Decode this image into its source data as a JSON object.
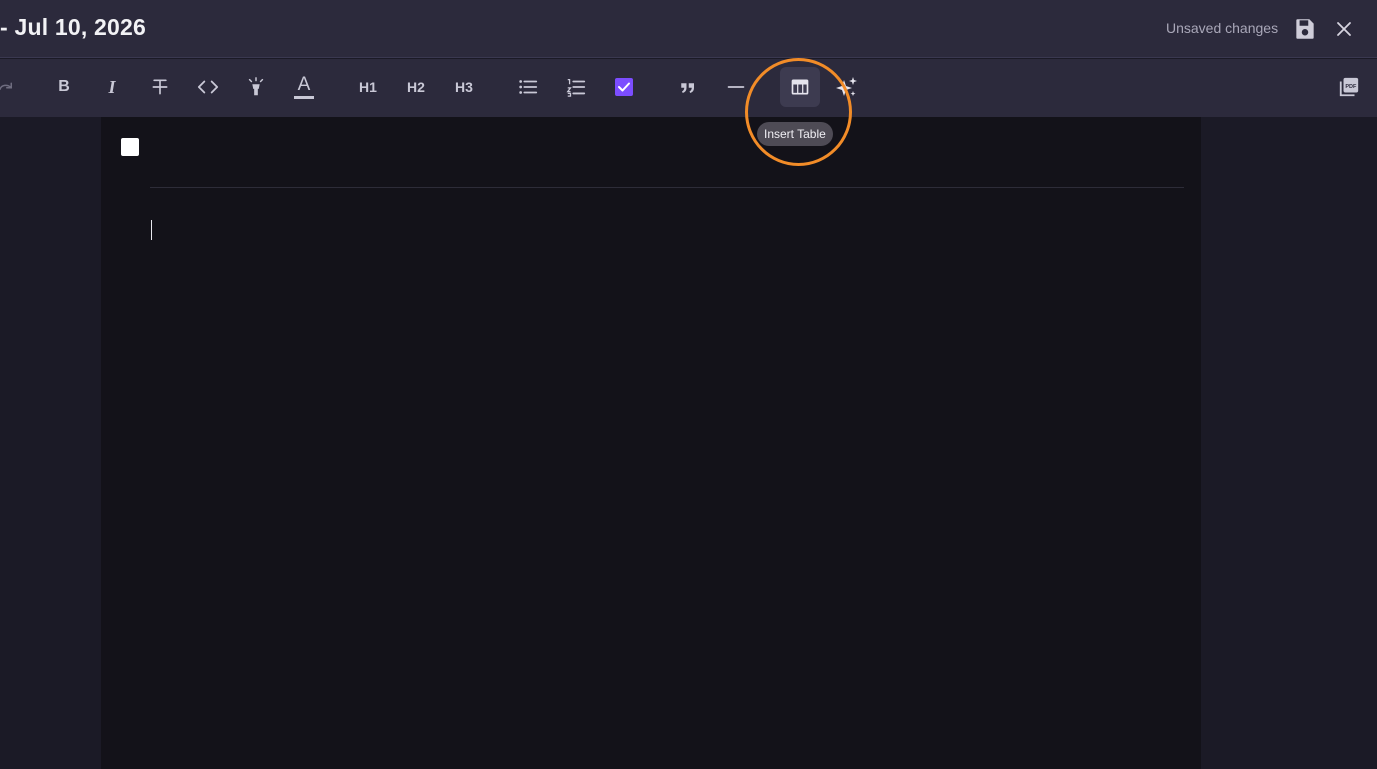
{
  "header": {
    "title": "- Jul 10, 2026",
    "status": "Unsaved changes",
    "save_icon": "save-icon",
    "close_icon": "close-icon"
  },
  "toolbar": {
    "buttons": [
      {
        "name": "redo",
        "icon": "redo-icon"
      },
      {
        "name": "bold",
        "icon": "bold-icon",
        "label": "B"
      },
      {
        "name": "italic",
        "icon": "italic-icon",
        "label": "I"
      },
      {
        "name": "strikethrough",
        "icon": "strikethrough-icon"
      },
      {
        "name": "code",
        "icon": "code-icon"
      },
      {
        "name": "highlight",
        "icon": "highlighter-icon"
      },
      {
        "name": "text-color",
        "icon": "text-color-icon",
        "label": "A"
      },
      {
        "name": "h1",
        "label": "H1"
      },
      {
        "name": "h2",
        "label": "H2"
      },
      {
        "name": "h3",
        "label": "H3"
      },
      {
        "name": "bullet-list",
        "icon": "bullet-list-icon"
      },
      {
        "name": "ordered-list",
        "icon": "ordered-list-icon"
      },
      {
        "name": "task-list",
        "icon": "checkbox-icon"
      },
      {
        "name": "blockquote",
        "icon": "quote-icon"
      },
      {
        "name": "horizontal-rule",
        "icon": "horizontal-rule-icon"
      },
      {
        "name": "insert-table",
        "icon": "table-icon"
      },
      {
        "name": "ai",
        "icon": "sparkles-icon"
      },
      {
        "name": "export-pdf",
        "icon": "pdf-icon"
      }
    ],
    "tooltip": "Insert Table"
  },
  "colors": {
    "accent_highlight": "#f28c28",
    "checkbox_accent": "#7c4dff",
    "toolbar_bg": "#2c2a3c",
    "editor_bg": "#131219"
  }
}
